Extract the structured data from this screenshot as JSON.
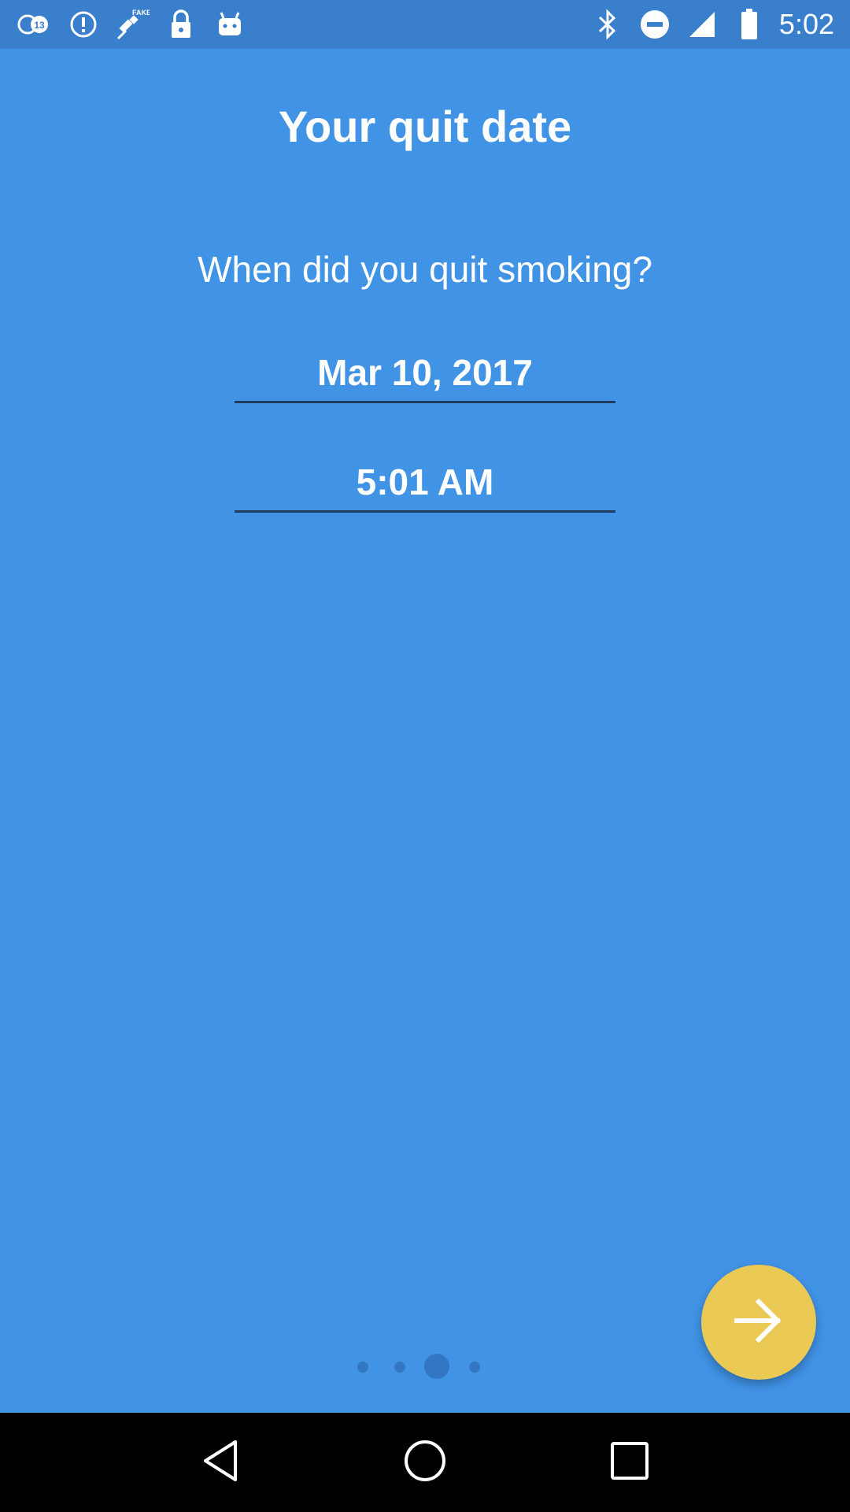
{
  "status_bar": {
    "time": "5:02",
    "left_icons": [
      "abc13-news-icon",
      "info-alert-icon",
      "fake-gps-satellite-icon",
      "lock-icon",
      "android-robot-icon"
    ],
    "right_icons": [
      "bluetooth-icon",
      "do-not-disturb-icon",
      "signal-icon",
      "battery-icon"
    ]
  },
  "main": {
    "title": "Your quit date",
    "question": "When did you quit smoking?",
    "date_value": "Mar 10, 2017",
    "time_value": "5:01 AM"
  },
  "pager": {
    "page_count": 4,
    "current_page": 3
  },
  "fab": {
    "icon": "arrow-right-icon"
  },
  "nav_bar": {
    "buttons": [
      "back-icon",
      "home-icon",
      "recents-icon"
    ]
  },
  "colors": {
    "background": "#4193e6",
    "status_bar": "#3a7fcc",
    "fab": "#ebc955",
    "underline": "#1f3d5c",
    "dot": "#3377c3"
  }
}
